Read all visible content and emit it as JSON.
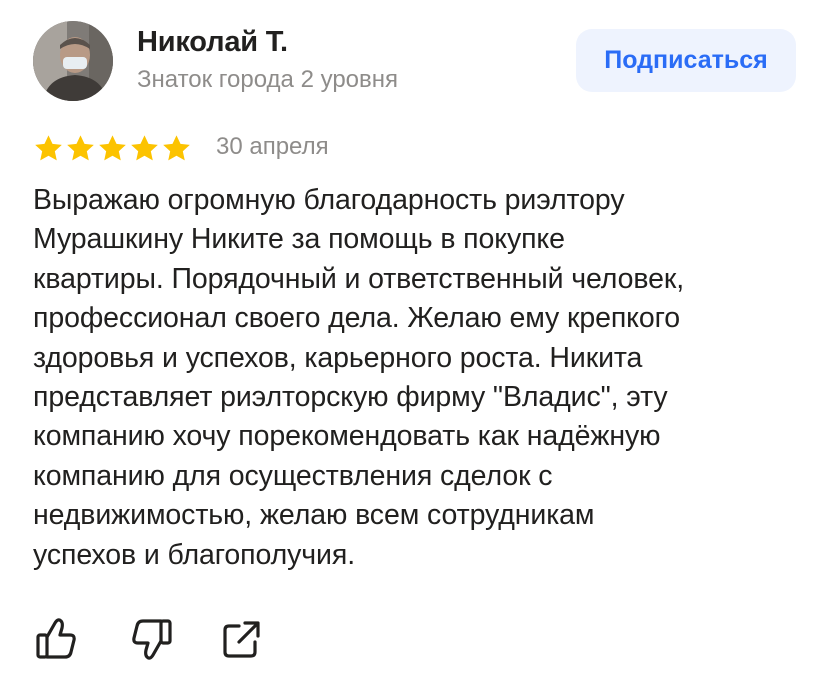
{
  "author": {
    "name": "Николай Т.",
    "level": "Знаток города 2 уровня",
    "avatar_icon": "user-photo-avatar"
  },
  "subscribe": {
    "label": "Подписаться",
    "color": "#2a6cf6",
    "background": "#eef3fe"
  },
  "review": {
    "rating": 5,
    "rating_max": 5,
    "star_color": "#fcc300",
    "date": "30 апреля",
    "text_lines": [
      "Выражаю огромную благодарность риэлтору",
      "Мурашкину Никите за помощь в покупке",
      "квартиры. Порядочный и ответственный человек,",
      "профессионал своего дела. Желаю ему крепкого",
      "здоровья и успехов, карьерного роста. Никита",
      "представляет риэлторскую фирму \"Владис\", эту",
      "компанию хочу порекомендовать как надёжную",
      "компанию для осуществления сделок с",
      "недвижимостью, желаю всем сотрудникам",
      "успехов и благополучия."
    ]
  },
  "actions": [
    {
      "name": "like",
      "icon": "thumbs-up-icon"
    },
    {
      "name": "dislike",
      "icon": "thumbs-down-icon"
    },
    {
      "name": "share",
      "icon": "share-icon"
    }
  ]
}
